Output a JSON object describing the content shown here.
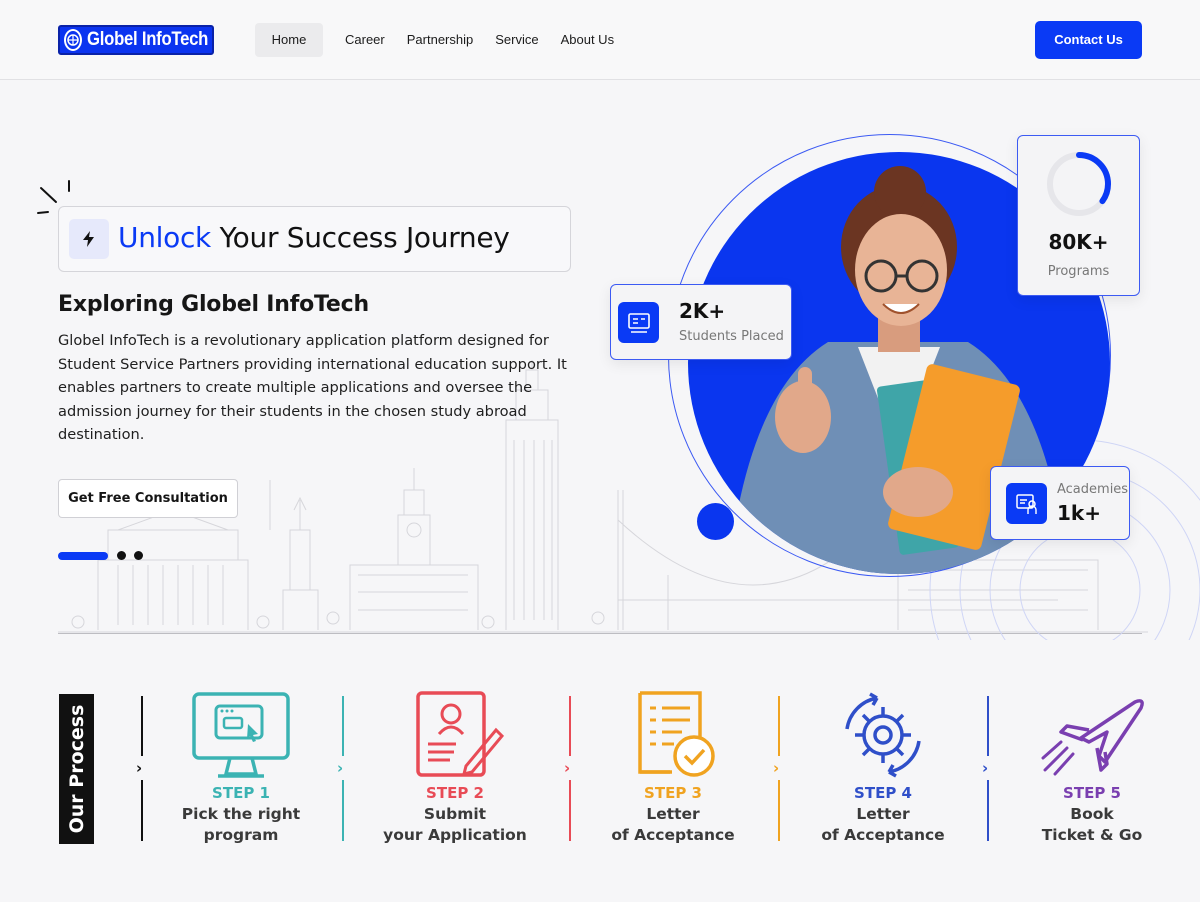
{
  "nav": {
    "logo_text": "Globel InfoTech",
    "links": [
      "Home",
      "Career",
      "Partnership",
      "Service",
      "About Us"
    ],
    "active": "Home",
    "contact_label": "Contact Us"
  },
  "hero": {
    "headline_accent": "Unlock",
    "headline_rest": "Your Success Journey",
    "subtitle": "Exploring Globel InfoTech",
    "description": "Globel InfoTech is a revolutionary application platform designed for Student Service Partners providing international education support. It enables partners to create multiple applications and oversee the admission journey for their students in the chosen study abroad destination.",
    "cta_label": "Get Free Consultation"
  },
  "stats": {
    "students": {
      "value": "2K+",
      "label": "Students Placed"
    },
    "programs": {
      "value": "80K+",
      "label": "Programs",
      "progress": 0.35
    },
    "academies": {
      "value": "1k+",
      "label": "Academies"
    }
  },
  "process": {
    "label": "Our Process",
    "steps": [
      {
        "step": "STEP 1",
        "line1": "Pick the right",
        "line2": "program",
        "color": "#3bb3b3",
        "icon": "monitor-icon"
      },
      {
        "step": "STEP 2",
        "line1": "Submit",
        "line2": "your Application",
        "color": "#e84b56",
        "icon": "document-user-icon"
      },
      {
        "step": "STEP 3",
        "line1": "Letter",
        "line2": "of Acceptance",
        "color": "#f0a320",
        "icon": "checked-document-icon"
      },
      {
        "step": "STEP 4",
        "line1": "Letter",
        "line2": "of Acceptance",
        "color": "#2f4fc9",
        "icon": "gear-icon"
      },
      {
        "step": "STEP 5",
        "line1": "Book",
        "line2": "Ticket & Go",
        "color": "#7a3fb0",
        "icon": "airplane-icon"
      }
    ]
  },
  "colors": {
    "brand": "#0a3af5",
    "text": "#111111"
  }
}
